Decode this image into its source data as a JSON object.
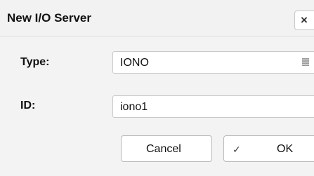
{
  "dialog": {
    "title": "New I/O Server",
    "close_label": "×"
  },
  "form": {
    "type_label": "Type:",
    "type_value": "IONO",
    "id_label": "ID:",
    "id_value": "iono1"
  },
  "buttons": {
    "cancel_label": "Cancel",
    "ok_label": "OK",
    "ok_icon": "✓"
  },
  "icons": {
    "type_select": "list-menu-icon",
    "ok": "check-icon",
    "close": "close-icon"
  }
}
